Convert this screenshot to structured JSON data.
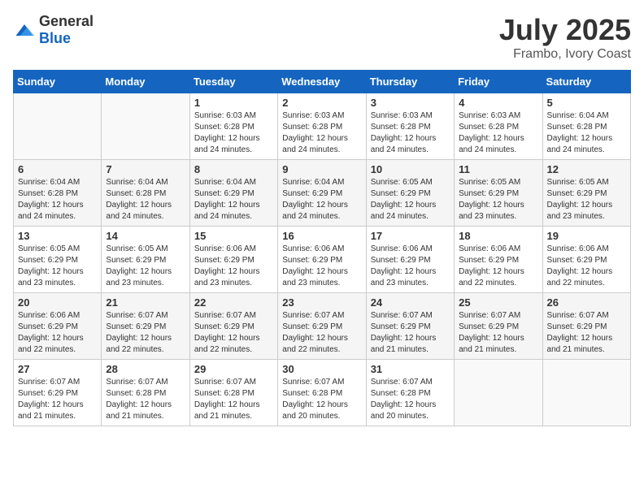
{
  "logo": {
    "general": "General",
    "blue": "Blue"
  },
  "title": "July 2025",
  "subtitle": "Frambo, Ivory Coast",
  "days_of_week": [
    "Sunday",
    "Monday",
    "Tuesday",
    "Wednesday",
    "Thursday",
    "Friday",
    "Saturday"
  ],
  "weeks": [
    [
      {
        "day": "",
        "info": ""
      },
      {
        "day": "",
        "info": ""
      },
      {
        "day": "1",
        "info": "Sunrise: 6:03 AM\nSunset: 6:28 PM\nDaylight: 12 hours and 24 minutes."
      },
      {
        "day": "2",
        "info": "Sunrise: 6:03 AM\nSunset: 6:28 PM\nDaylight: 12 hours and 24 minutes."
      },
      {
        "day": "3",
        "info": "Sunrise: 6:03 AM\nSunset: 6:28 PM\nDaylight: 12 hours and 24 minutes."
      },
      {
        "day": "4",
        "info": "Sunrise: 6:03 AM\nSunset: 6:28 PM\nDaylight: 12 hours and 24 minutes."
      },
      {
        "day": "5",
        "info": "Sunrise: 6:04 AM\nSunset: 6:28 PM\nDaylight: 12 hours and 24 minutes."
      }
    ],
    [
      {
        "day": "6",
        "info": "Sunrise: 6:04 AM\nSunset: 6:28 PM\nDaylight: 12 hours and 24 minutes."
      },
      {
        "day": "7",
        "info": "Sunrise: 6:04 AM\nSunset: 6:28 PM\nDaylight: 12 hours and 24 minutes."
      },
      {
        "day": "8",
        "info": "Sunrise: 6:04 AM\nSunset: 6:29 PM\nDaylight: 12 hours and 24 minutes."
      },
      {
        "day": "9",
        "info": "Sunrise: 6:04 AM\nSunset: 6:29 PM\nDaylight: 12 hours and 24 minutes."
      },
      {
        "day": "10",
        "info": "Sunrise: 6:05 AM\nSunset: 6:29 PM\nDaylight: 12 hours and 24 minutes."
      },
      {
        "day": "11",
        "info": "Sunrise: 6:05 AM\nSunset: 6:29 PM\nDaylight: 12 hours and 23 minutes."
      },
      {
        "day": "12",
        "info": "Sunrise: 6:05 AM\nSunset: 6:29 PM\nDaylight: 12 hours and 23 minutes."
      }
    ],
    [
      {
        "day": "13",
        "info": "Sunrise: 6:05 AM\nSunset: 6:29 PM\nDaylight: 12 hours and 23 minutes."
      },
      {
        "day": "14",
        "info": "Sunrise: 6:05 AM\nSunset: 6:29 PM\nDaylight: 12 hours and 23 minutes."
      },
      {
        "day": "15",
        "info": "Sunrise: 6:06 AM\nSunset: 6:29 PM\nDaylight: 12 hours and 23 minutes."
      },
      {
        "day": "16",
        "info": "Sunrise: 6:06 AM\nSunset: 6:29 PM\nDaylight: 12 hours and 23 minutes."
      },
      {
        "day": "17",
        "info": "Sunrise: 6:06 AM\nSunset: 6:29 PM\nDaylight: 12 hours and 23 minutes."
      },
      {
        "day": "18",
        "info": "Sunrise: 6:06 AM\nSunset: 6:29 PM\nDaylight: 12 hours and 22 minutes."
      },
      {
        "day": "19",
        "info": "Sunrise: 6:06 AM\nSunset: 6:29 PM\nDaylight: 12 hours and 22 minutes."
      }
    ],
    [
      {
        "day": "20",
        "info": "Sunrise: 6:06 AM\nSunset: 6:29 PM\nDaylight: 12 hours and 22 minutes."
      },
      {
        "day": "21",
        "info": "Sunrise: 6:07 AM\nSunset: 6:29 PM\nDaylight: 12 hours and 22 minutes."
      },
      {
        "day": "22",
        "info": "Sunrise: 6:07 AM\nSunset: 6:29 PM\nDaylight: 12 hours and 22 minutes."
      },
      {
        "day": "23",
        "info": "Sunrise: 6:07 AM\nSunset: 6:29 PM\nDaylight: 12 hours and 22 minutes."
      },
      {
        "day": "24",
        "info": "Sunrise: 6:07 AM\nSunset: 6:29 PM\nDaylight: 12 hours and 21 minutes."
      },
      {
        "day": "25",
        "info": "Sunrise: 6:07 AM\nSunset: 6:29 PM\nDaylight: 12 hours and 21 minutes."
      },
      {
        "day": "26",
        "info": "Sunrise: 6:07 AM\nSunset: 6:29 PM\nDaylight: 12 hours and 21 minutes."
      }
    ],
    [
      {
        "day": "27",
        "info": "Sunrise: 6:07 AM\nSunset: 6:29 PM\nDaylight: 12 hours and 21 minutes."
      },
      {
        "day": "28",
        "info": "Sunrise: 6:07 AM\nSunset: 6:28 PM\nDaylight: 12 hours and 21 minutes."
      },
      {
        "day": "29",
        "info": "Sunrise: 6:07 AM\nSunset: 6:28 PM\nDaylight: 12 hours and 21 minutes."
      },
      {
        "day": "30",
        "info": "Sunrise: 6:07 AM\nSunset: 6:28 PM\nDaylight: 12 hours and 20 minutes."
      },
      {
        "day": "31",
        "info": "Sunrise: 6:07 AM\nSunset: 6:28 PM\nDaylight: 12 hours and 20 minutes."
      },
      {
        "day": "",
        "info": ""
      },
      {
        "day": "",
        "info": ""
      }
    ]
  ]
}
